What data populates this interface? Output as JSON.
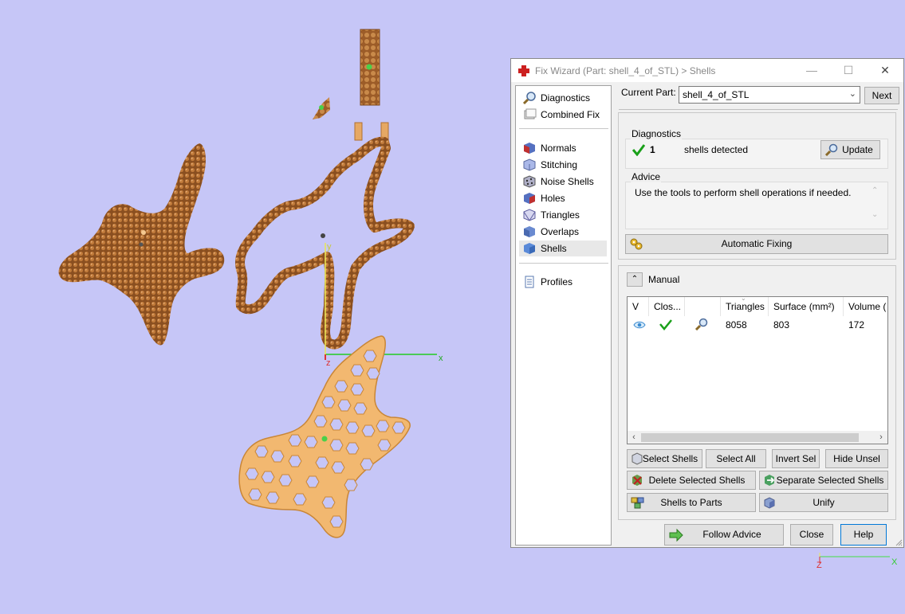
{
  "viewport": {
    "axis_labels": {
      "x": "x",
      "y": "y",
      "z": "z"
    },
    "corner_axis_labels": {
      "z": "Z",
      "x": "X"
    }
  },
  "window": {
    "title": "Fix Wizard (Part: shell_4_of_STL) > Shells",
    "controls": {
      "minimize": "—",
      "maximize": "☐",
      "close": "✕"
    }
  },
  "nav": {
    "top": [
      {
        "label": "Diagnostics",
        "icon": "magnifier-icon"
      },
      {
        "label": "Combined Fix",
        "icon": "combined-fix-icon"
      }
    ],
    "fixes": [
      {
        "label": "Normals",
        "icon": "normals-cube-icon"
      },
      {
        "label": "Stitching",
        "icon": "stitching-cube-icon"
      },
      {
        "label": "Noise Shells",
        "icon": "noise-shells-icon"
      },
      {
        "label": "Holes",
        "icon": "holes-cube-icon"
      },
      {
        "label": "Triangles",
        "icon": "triangles-cube-icon"
      },
      {
        "label": "Overlaps",
        "icon": "overlaps-cube-icon"
      },
      {
        "label": "Shells",
        "icon": "shells-cube-icon",
        "selected": true
      }
    ],
    "bottom": [
      {
        "label": "Profiles",
        "icon": "profiles-document-icon"
      }
    ]
  },
  "current_part": {
    "label": "Current Part:",
    "value": "shell_4_of_STL",
    "next_label": "Next"
  },
  "diagnostics": {
    "title": "Diagnostics",
    "count": "1",
    "text": "shells detected",
    "update_label": "Update"
  },
  "advice": {
    "title": "Advice",
    "text": "Use the tools to perform shell operations if needed.",
    "auto_fix_label": "Automatic Fixing"
  },
  "manual": {
    "label": "Manual",
    "columns": [
      "V",
      "Clos...",
      "",
      "Triangles",
      "Surface (mm²)",
      "Volume ("
    ],
    "rows": [
      {
        "triangles": "8058",
        "surface": "803",
        "volume": "172"
      }
    ]
  },
  "actions": {
    "select_shells": "Select Shells",
    "select_all": "Select All",
    "invert_sel": "Invert Sel",
    "hide_unsel": "Hide Unsel",
    "delete_selected": "Delete Selected Shells",
    "separate_selected": "Separate Selected Shells",
    "shells_to_parts": "Shells to Parts",
    "unify": "Unify"
  },
  "footer": {
    "follow_advice": "Follow Advice",
    "close": "Close",
    "help": "Help"
  },
  "colors": {
    "background": "#c6c6f7",
    "part_dark": "#a0622c",
    "part_light": "#f2b870",
    "check_green": "#1aa01a",
    "axis_green": "#22cc22",
    "axis_yellow": "#e8e855",
    "axis_red": "#dd3333",
    "title_red": "#cc2020"
  }
}
